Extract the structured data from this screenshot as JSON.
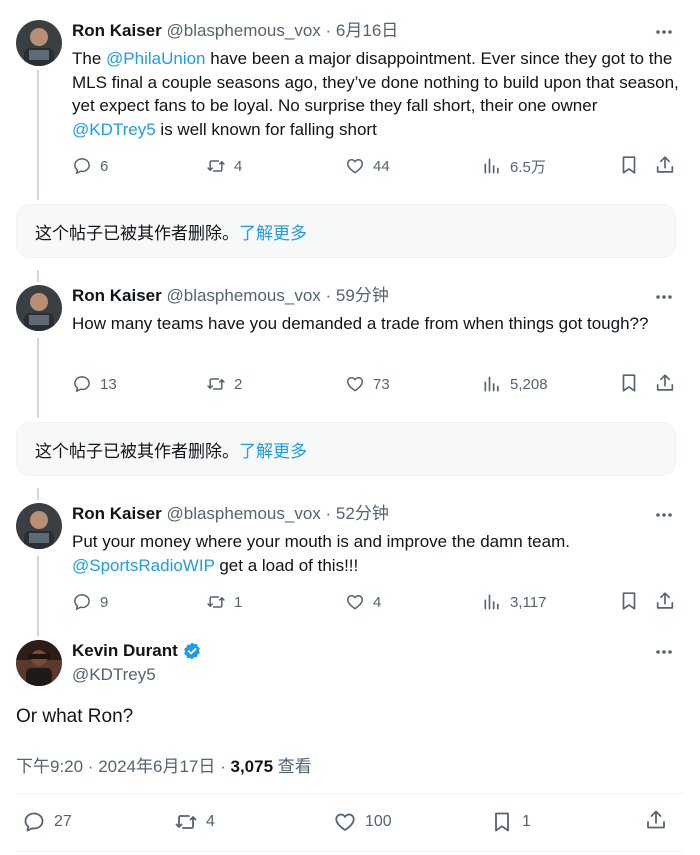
{
  "tweets": [
    {
      "name": "Ron Kaiser",
      "handle": "@blasphemous_vox",
      "sep": "·",
      "time": "6月16日",
      "text_parts": [
        "The ",
        "@PhilaUnion",
        " have been a major disappointment. Ever since they got to the MLS final a couple seasons ago, they’ve done nothing to build upon that season, yet expect fans to be loyal. No surprise they fall short, their one owner ",
        "@KDTrey5",
        " is well known for falling short"
      ],
      "replies": "6",
      "retweets": "4",
      "likes": "44",
      "views": "6.5万"
    },
    {
      "name": "Ron Kaiser",
      "handle": "@blasphemous_vox",
      "sep": "·",
      "time": "59分钟",
      "text": "How many teams have you demanded a trade from when things got tough??",
      "replies": "13",
      "retweets": "2",
      "likes": "73",
      "views": "5,208"
    },
    {
      "name": "Ron Kaiser",
      "handle": "@blasphemous_vox",
      "sep": "·",
      "time": "52分钟",
      "text_line1": "Put your money where your mouth is and improve the damn team.",
      "mention": "@SportsRadioWIP",
      "text_after": " get a load of this!!!",
      "replies": "9",
      "retweets": "1",
      "likes": "4",
      "views": "3,117"
    }
  ],
  "deleted_notice": {
    "text": "这个帖子已被其作者删除。",
    "link": "了解更多"
  },
  "main_tweet": {
    "name": "Kevin Durant",
    "handle": "@KDTrey5",
    "text": "Or what Ron?",
    "time": "下午9:20 · 2024年6月17日 · ",
    "views_count": "3,075",
    "views_label": " 查看",
    "replies": "27",
    "retweets": "4",
    "likes": "100",
    "bookmarks": "1"
  },
  "colors": {
    "link": "#1d9bf0",
    "muted": "#536471",
    "verified": "#1d9bf0"
  }
}
